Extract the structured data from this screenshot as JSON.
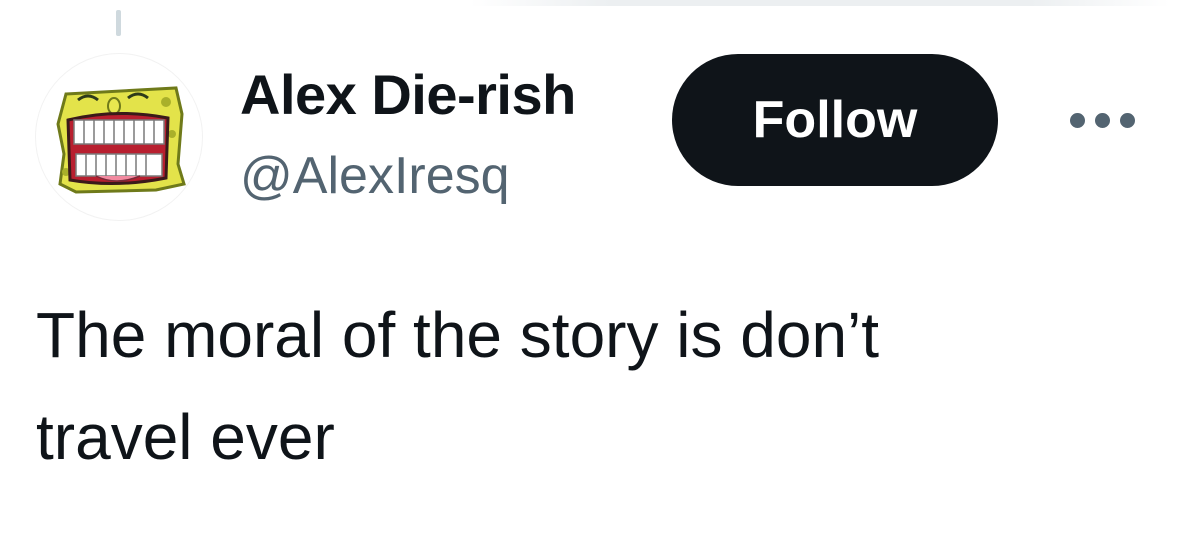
{
  "author": {
    "display_name": "Alex Die-rish",
    "handle": "@AlexIresq",
    "avatar": "spongebob-laughing-avatar"
  },
  "actions": {
    "follow_label": "Follow",
    "more_icon": "more-horizontal-icon"
  },
  "tweet": {
    "text": "The moral of the story is don’t\ntravel ever"
  },
  "colors": {
    "text_primary": "#0f1419",
    "text_secondary": "#536471",
    "follow_bg": "#0f1419",
    "follow_text": "#ffffff",
    "thread_line": "#cfd9de"
  }
}
